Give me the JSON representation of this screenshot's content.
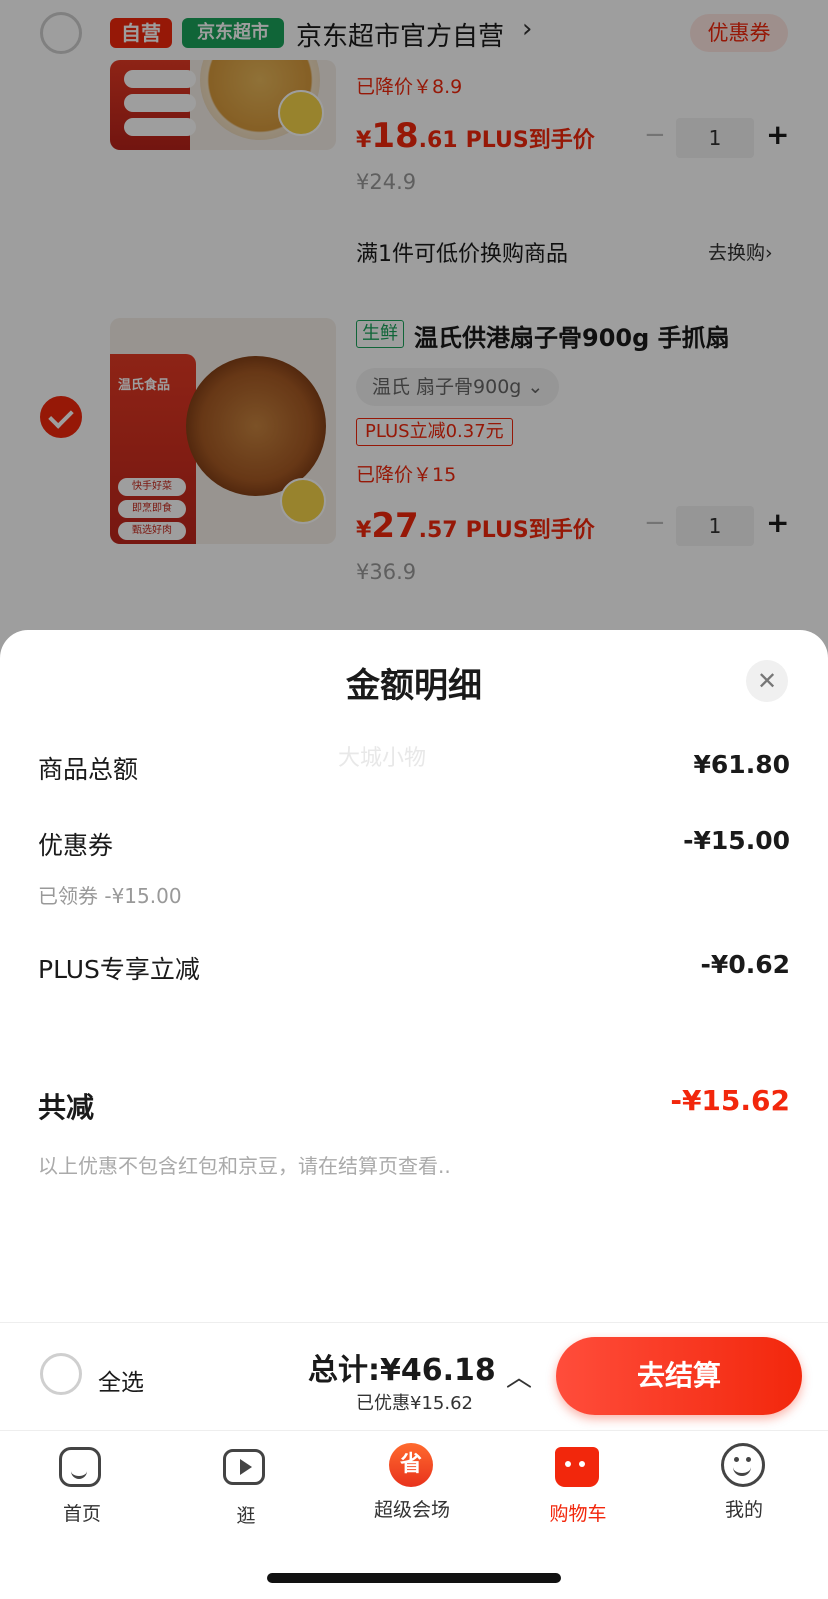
{
  "shop": {
    "tag_self": "自营",
    "tag_market": "京东超市",
    "name": "京东超市官方自营",
    "chevron": "›",
    "coupon_button": "优惠券"
  },
  "items": [
    {
      "price_cut": "已降价￥8.9",
      "price_symbol": "¥",
      "price_int": "18",
      "price_dec": ".61",
      "plus_label": "PLUS到手价",
      "original_price": "¥24.9",
      "qty": "1",
      "exchange_text": "满1件可低价换购商品",
      "exchange_link": "去换购›",
      "checked": false
    },
    {
      "fresh_tag": "生鲜",
      "title": "温氏供港扇子骨900g 手抓扇",
      "spec": "温氏 扇子骨900g  ⌄",
      "plus_discount": "PLUS立减0.37元",
      "price_cut": "已降价￥15",
      "price_symbol": "¥",
      "price_int": "27",
      "price_dec": ".57",
      "plus_label": "PLUS到手价",
      "original_price": "¥36.9",
      "qty": "1",
      "checked": true
    }
  ],
  "product_image_text": {
    "brand": "温氏食品",
    "tags": [
      "快手好菜",
      "即烹即食",
      "甄选好肉"
    ]
  },
  "sheet": {
    "title": "金额明细",
    "watermark": "大城小物",
    "rows": [
      {
        "label": "商品总额",
        "value": "¥61.80"
      },
      {
        "label": "优惠券",
        "value": "-¥15.00",
        "sub": "已领券 -¥15.00"
      },
      {
        "label": "PLUS专享立减",
        "value": "-¥0.62"
      }
    ],
    "total_label": "共减",
    "total_value": "-¥15.62",
    "note": "以上优惠不包含红包和京豆，请在结算页查看.."
  },
  "checkout": {
    "select_all": "全选",
    "total": "总计:¥46.18",
    "saved": "已优惠¥15.62",
    "caret": "︿",
    "pay_button": "去结算"
  },
  "tabs": [
    {
      "label": "首页",
      "icon": "home-icon"
    },
    {
      "label": "逛",
      "icon": "video-icon"
    },
    {
      "label": "超级会场",
      "icon": "super-venue-icon"
    },
    {
      "label": "购物车",
      "icon": "cart-icon",
      "active": true
    },
    {
      "label": "我的",
      "icon": "profile-icon"
    }
  ],
  "colors": {
    "accent": "#f2270c",
    "market_green": "#1aa35b"
  }
}
